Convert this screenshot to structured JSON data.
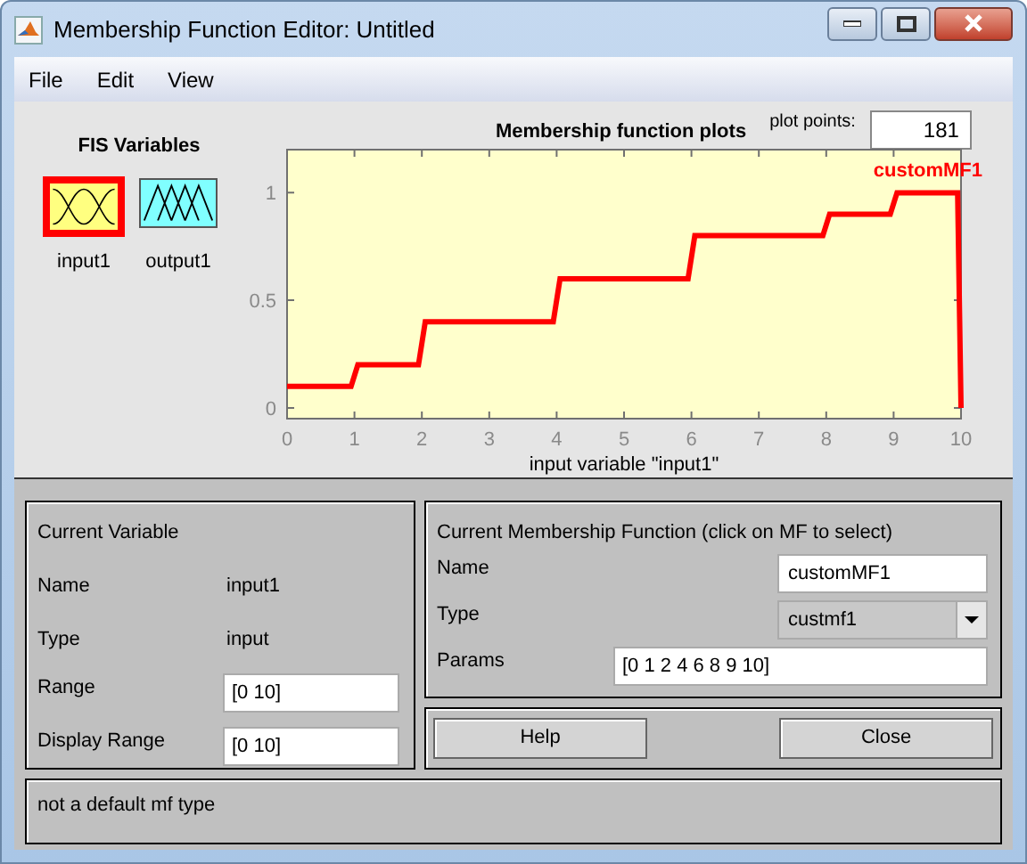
{
  "window": {
    "title": "Membership Function Editor: Untitled"
  },
  "menu": [
    "File",
    "Edit",
    "View"
  ],
  "fis_variables": {
    "title": "FIS Variables",
    "variables": [
      {
        "name": "input1",
        "kind": "input",
        "selected": true
      },
      {
        "name": "output1",
        "kind": "output",
        "selected": false
      }
    ]
  },
  "plot": {
    "title": "Membership function plots",
    "plot_points": {
      "label": "plot points:",
      "value": "181"
    },
    "chart_data": {
      "type": "line",
      "xlabel": "input variable \"input1\"",
      "x": [
        0,
        0.95,
        1.05,
        1.95,
        2.05,
        3.95,
        4.05,
        5.95,
        6.05,
        7.95,
        8.05,
        8.95,
        9.05,
        9.95,
        10
      ],
      "series": [
        {
          "name": "customMF1",
          "color": "#ff0000",
          "values": [
            0.1,
            0.1,
            0.2,
            0.2,
            0.4,
            0.4,
            0.6,
            0.6,
            0.8,
            0.8,
            0.9,
            0.9,
            1,
            1,
            0
          ]
        }
      ],
      "xlim": [
        0,
        10
      ],
      "ylim": [
        -0.05,
        1.2
      ],
      "xticks": [
        0,
        1,
        2,
        3,
        4,
        5,
        6,
        7,
        8,
        9,
        10
      ],
      "yticks": [
        0,
        0.5,
        1
      ]
    }
  },
  "current_variable": {
    "title": "Current Variable",
    "name_label": "Name",
    "name": "input1",
    "type_label": "Type",
    "type": "input",
    "range_label": "Range",
    "range": "[0 10]",
    "display_range_label": "Display Range",
    "display_range": "[0 10]"
  },
  "current_mf": {
    "title": "Current Membership Function (click on MF to select)",
    "name_label": "Name",
    "name": "customMF1",
    "type_label": "Type",
    "type": "custmf1",
    "params_label": "Params",
    "params": "[0 1 2 4 6 8 9 10]"
  },
  "buttons": [
    "Help",
    "Close"
  ],
  "status": "not a default mf type"
}
